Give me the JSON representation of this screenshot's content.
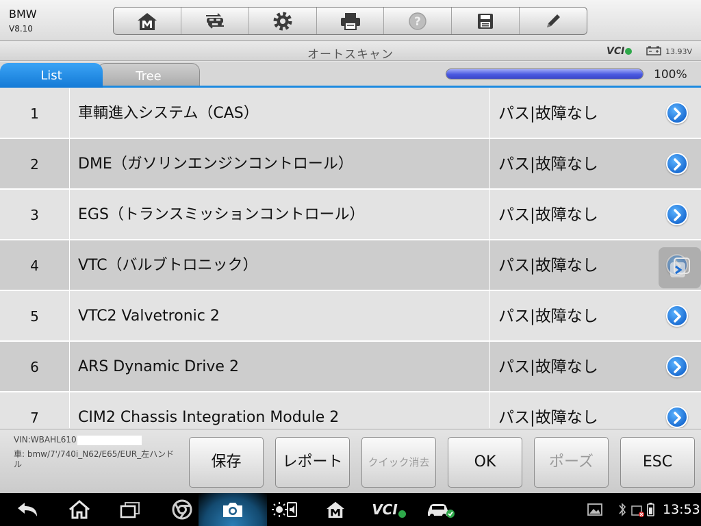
{
  "app": {
    "brand": "BMW",
    "version": "V8.10"
  },
  "toolbar": {
    "buttons": [
      {
        "icon": "home-m-icon"
      },
      {
        "icon": "vehicle-swap-icon"
      },
      {
        "icon": "gear-icon"
      },
      {
        "icon": "printer-icon"
      },
      {
        "icon": "help-icon"
      },
      {
        "icon": "save-disk-icon"
      },
      {
        "icon": "pencil-icon"
      }
    ]
  },
  "titlebar": {
    "title": "オートスキャン",
    "vci": "VCI",
    "voltage": "13.93V"
  },
  "tabs": {
    "list": "List",
    "tree": "Tree",
    "active": "List"
  },
  "progress": {
    "value": 1.0,
    "label": "100%"
  },
  "rows": [
    {
      "num": "1",
      "name": "車輌進入システム（CAS）",
      "status": "パス|故障なし"
    },
    {
      "num": "2",
      "name": "DME（ガソリンエンジンコントロール）",
      "status": "パス|故障なし"
    },
    {
      "num": "3",
      "name": "EGS（トランスミッションコントロール）",
      "status": "パス|故障なし"
    },
    {
      "num": "4",
      "name": "VTC（バルブトロニック）",
      "status": "パス|故障なし"
    },
    {
      "num": "5",
      "name": "VTC2 Valvetronic 2",
      "status": "パス|故障なし"
    },
    {
      "num": "6",
      "name": "ARS Dynamic Drive 2",
      "status": "パス|故障なし"
    },
    {
      "num": "7",
      "name": "CIM2 Chassis Integration Module 2",
      "status": "パス|故障なし"
    }
  ],
  "vehicle": {
    "vin": "VIN:WBAHL610",
    "car": "車: bmw/7'/740i_N62/E65/EUR_左ハンドル"
  },
  "actions": {
    "save": "保存",
    "report": "レポート",
    "quick_clear": "クイック消去",
    "ok": "OK",
    "pause": "ポーズ",
    "esc": "ESC"
  },
  "system": {
    "clock": "13:53",
    "nav_vci": "VCI"
  },
  "colors": {
    "accent": "#1c8ae0",
    "progress": "#4a5ae0",
    "ok_green": "#2ea84a"
  }
}
